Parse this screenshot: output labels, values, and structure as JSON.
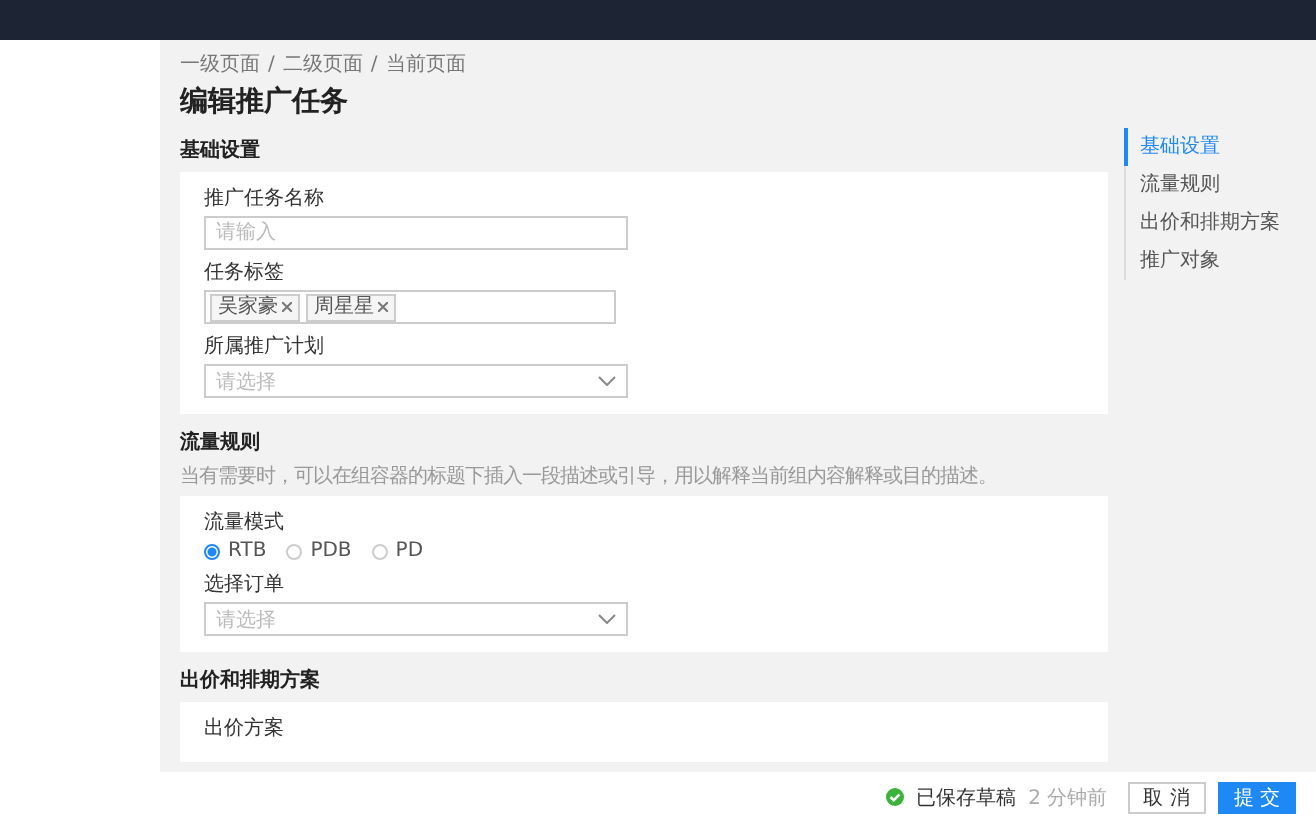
{
  "breadcrumb": {
    "items": [
      "一级页面",
      "二级页面",
      "当前页面"
    ],
    "separator": "/"
  },
  "title": "编辑推广任务",
  "sections": [
    {
      "heading": "基础设置",
      "fields": [
        {
          "kind": "input",
          "label": "推广任务名称",
          "placeholder": "请输入"
        },
        {
          "kind": "tags",
          "label": "任务标签",
          "tags": [
            "吴家豪",
            "周星星"
          ]
        },
        {
          "kind": "select",
          "label": "所属推广计划",
          "placeholder": "请选择"
        }
      ]
    },
    {
      "heading": "流量规则",
      "description": "当有需要时，可以在组容器的标题下插入一段描述或引导，用以解释当前组内容解释或目的描述。",
      "fields": [
        {
          "kind": "radio",
          "label": "流量模式",
          "options": [
            {
              "label": "RTB",
              "selected": true
            },
            {
              "label": "PDB",
              "selected": false
            },
            {
              "label": "PD",
              "selected": false
            }
          ]
        },
        {
          "kind": "select",
          "label": "选择订单",
          "placeholder": "请选择"
        }
      ]
    },
    {
      "heading": "出价和排期方案",
      "fields": [
        {
          "kind": "label",
          "label": "出价方案"
        }
      ]
    }
  ],
  "anchor_nav": [
    {
      "label": "基础设置",
      "selected": true
    },
    {
      "label": "流量规则",
      "selected": false
    },
    {
      "label": "出价和排期方案",
      "selected": false
    },
    {
      "label": "推广对象",
      "selected": false
    }
  ],
  "footer": {
    "status": "已保存草稿",
    "time": "2 分钟前",
    "buttons": [
      {
        "label": "取 消",
        "kind": "default"
      },
      {
        "label": "提 交",
        "kind": "primary"
      }
    ]
  }
}
